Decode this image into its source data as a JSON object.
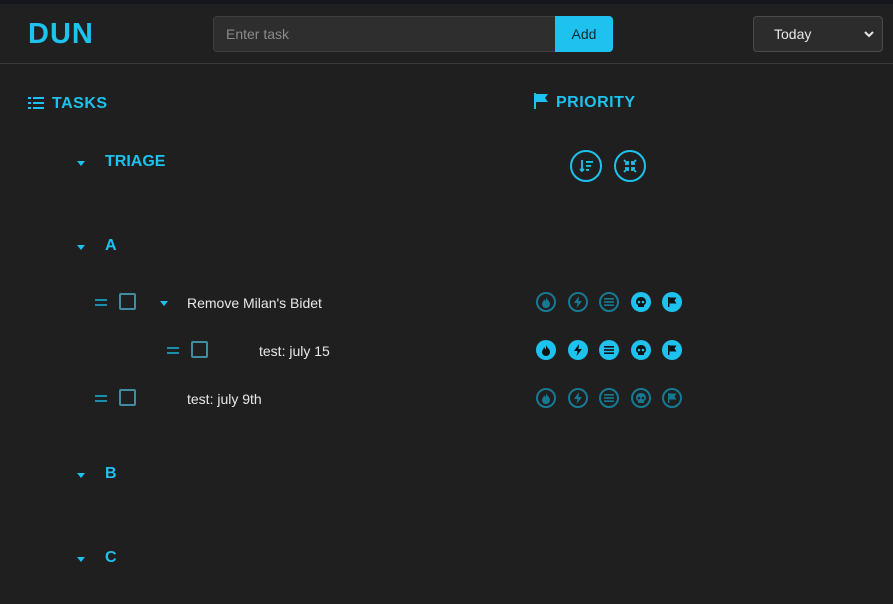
{
  "app": {
    "logo": "DUN"
  },
  "header": {
    "task_input_placeholder": "Enter task",
    "add_label": "Add",
    "date_filter": "Today"
  },
  "tasks_heading": "TASKS",
  "priority_heading": "PRIORITY",
  "groups": [
    {
      "label": "TRIAGE"
    },
    {
      "label": "A"
    },
    {
      "label": "B"
    },
    {
      "label": "C"
    }
  ],
  "tasks": [
    {
      "text": "Remove Milan's Bidet",
      "level": 0,
      "has_children": true,
      "priorities_active": [
        false,
        false,
        false,
        true,
        true
      ]
    },
    {
      "text": "test: july 15",
      "level": 1,
      "has_children": false,
      "priorities_active": [
        true,
        true,
        true,
        true,
        true
      ]
    },
    {
      "text": "test: july 9th",
      "level": 0,
      "has_children": false,
      "priorities_active": [
        false,
        false,
        false,
        false,
        false
      ]
    }
  ],
  "priority_icons": [
    "fire-icon",
    "lightning-icon",
    "bars-icon",
    "skull-icon",
    "flag-icon"
  ],
  "colors": {
    "accent": "#1dc2ee",
    "background": "#1f1f1f",
    "muted_accent": "#177a93"
  }
}
